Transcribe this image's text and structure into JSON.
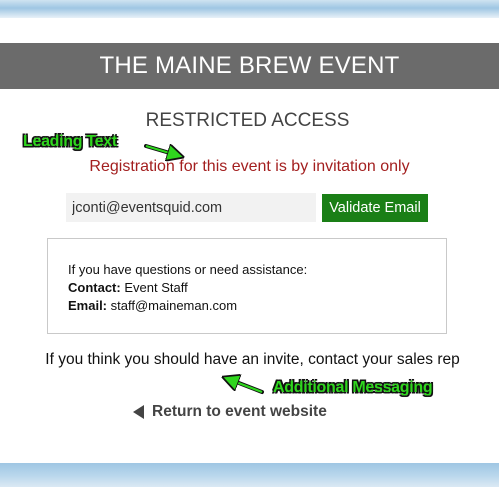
{
  "header": {
    "title": "THE MAINE BREW EVENT"
  },
  "page": {
    "subtitle": "RESTRICTED ACCESS",
    "leading_text": "Registration for this event is by invitation only"
  },
  "form": {
    "email_value": "jconti@eventsquid.com",
    "validate_label": "Validate Email"
  },
  "help": {
    "intro": "If you have questions or need assistance:",
    "contact_label": "Contact:",
    "contact_value": "Event Staff",
    "email_label": "Email:",
    "email_value": "staff@maineman.com"
  },
  "additional_message": "If you think you should have an invite, contact your sales rep",
  "return_link": {
    "label": "Return to event website",
    "icon": "triangle-left-icon"
  },
  "annotations": {
    "leading": "Leading Text",
    "additional": "Additional Messaging",
    "color": "#2fd61e"
  },
  "colors": {
    "header_bg": "#6b6b6b",
    "leading_text": "#a31f1f",
    "button_bg": "#1a7f16"
  }
}
